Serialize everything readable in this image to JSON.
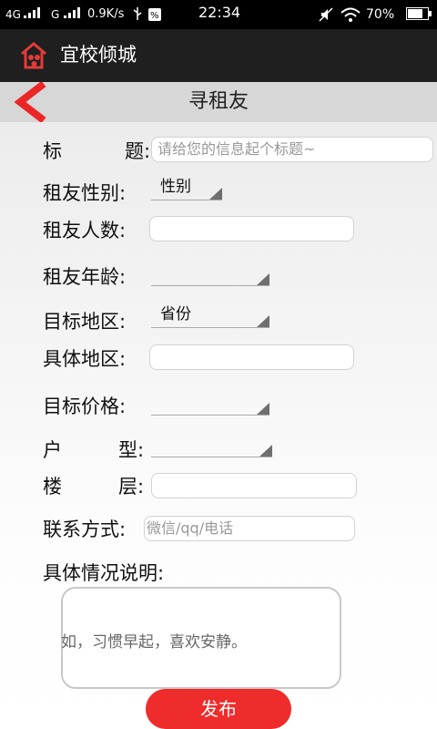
{
  "status_bar": {
    "signal_1": "4G",
    "signal_2": "G",
    "speed": "0.9K/s",
    "time": "22:34",
    "battery": "70%"
  },
  "app_bar": {
    "title": "宜校倾城",
    "logo_icon": "house-people-logo-icon"
  },
  "page": {
    "title": "寻租友",
    "back_icon": "chevron-left-icon"
  },
  "form": {
    "title_label_1": "标",
    "title_label_2": "题:",
    "title_placeholder": "请给您的信息起个标题~",
    "gender_label": "租友性别:",
    "gender_value": "性别",
    "count_label": "租友人数:",
    "age_label": "租友年龄:",
    "area_label": "目标地区:",
    "area_value": "省份",
    "detail_area_label": "具体地区:",
    "price_label": "目标价格:",
    "house_label_1": "户",
    "house_label_2": "型:",
    "floor_label_1": "楼",
    "floor_label_2": "层:",
    "contact_label": "联系方式:",
    "contact_placeholder": "微信/qq/电话",
    "desc_label": "具体情况说明:",
    "desc_placeholder": "如，习惯早起，喜欢安静。"
  },
  "actions": {
    "publish": "发布"
  },
  "colors": {
    "accent": "#ee2c2c",
    "appbar": "#1f1f1f",
    "titlebar": "#d7d7d7"
  }
}
